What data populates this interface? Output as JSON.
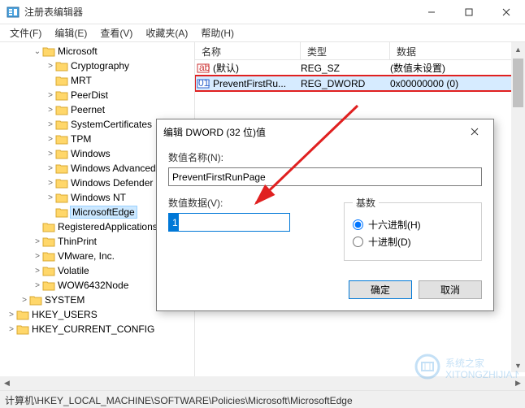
{
  "window": {
    "title": "注册表编辑器",
    "min": "—",
    "max": "☐",
    "close": "✕"
  },
  "menu": [
    "文件(F)",
    "编辑(E)",
    "查看(V)",
    "收藏夹(A)",
    "帮助(H)"
  ],
  "tree": [
    {
      "indent": 2,
      "tw": "⌄",
      "label": "Microsoft"
    },
    {
      "indent": 3,
      "tw": ">",
      "label": "Cryptography"
    },
    {
      "indent": 3,
      "tw": "",
      "label": "MRT"
    },
    {
      "indent": 3,
      "tw": ">",
      "label": "PeerDist"
    },
    {
      "indent": 3,
      "tw": ">",
      "label": "Peernet"
    },
    {
      "indent": 3,
      "tw": ">",
      "label": "SystemCertificates"
    },
    {
      "indent": 3,
      "tw": ">",
      "label": "TPM"
    },
    {
      "indent": 3,
      "tw": ">",
      "label": "Windows"
    },
    {
      "indent": 3,
      "tw": ">",
      "label": "Windows Advanced"
    },
    {
      "indent": 3,
      "tw": ">",
      "label": "Windows Defender"
    },
    {
      "indent": 3,
      "tw": ">",
      "label": "Windows NT"
    },
    {
      "indent": 3,
      "tw": "",
      "label": "MicrosoftEdge",
      "sel": true
    },
    {
      "indent": 2,
      "tw": "",
      "label": "RegisteredApplications"
    },
    {
      "indent": 2,
      "tw": ">",
      "label": "ThinPrint"
    },
    {
      "indent": 2,
      "tw": ">",
      "label": "VMware, Inc."
    },
    {
      "indent": 2,
      "tw": ">",
      "label": "Volatile"
    },
    {
      "indent": 2,
      "tw": ">",
      "label": "WOW6432Node"
    },
    {
      "indent": 1,
      "tw": ">",
      "label": "SYSTEM"
    },
    {
      "indent": 0,
      "tw": ">",
      "label": "HKEY_USERS"
    },
    {
      "indent": 0,
      "tw": ">",
      "label": "HKEY_CURRENT_CONFIG"
    }
  ],
  "listHeaders": {
    "name": "名称",
    "type": "类型",
    "data": "数据"
  },
  "listRows": [
    {
      "icon": "ab",
      "name": "(默认)",
      "type": "REG_SZ",
      "data": "(数值未设置)"
    },
    {
      "icon": "num",
      "name": "PreventFirstRu...",
      "type": "REG_DWORD",
      "data": "0x00000000 (0)",
      "hl": true
    }
  ],
  "statusbar": "计算机\\HKEY_LOCAL_MACHINE\\SOFTWARE\\Policies\\Microsoft\\MicrosoftEdge",
  "dialog": {
    "title": "编辑 DWORD (32 位)值",
    "nameLabel": "数值名称(N):",
    "nameValue": "PreventFirstRunPage",
    "dataLabel": "数值数据(V):",
    "dataValue": "1",
    "baseLegend": "基数",
    "hex": "十六进制(H)",
    "dec": "十进制(D)",
    "ok": "确定",
    "cancel": "取消"
  },
  "watermark": "系统之家"
}
